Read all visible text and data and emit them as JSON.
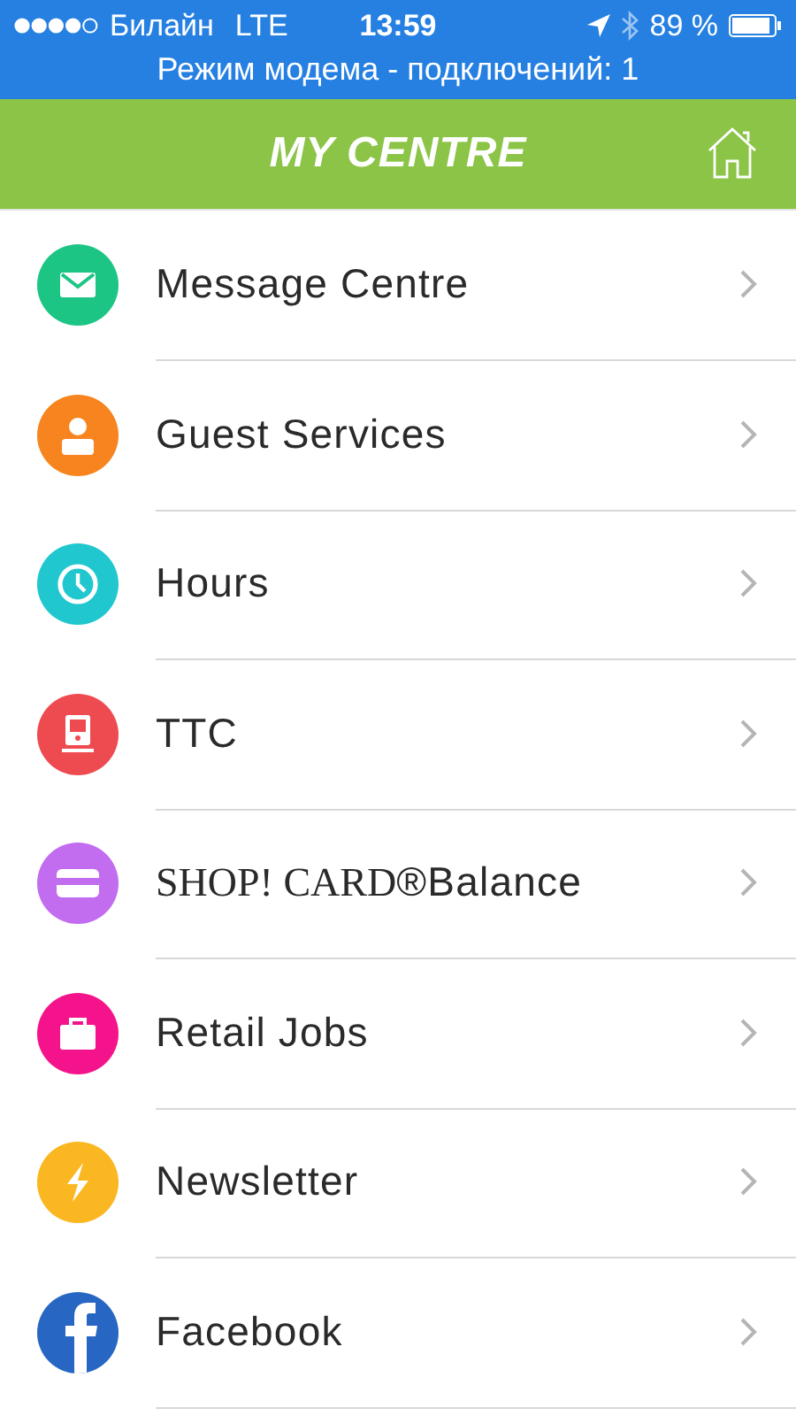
{
  "status_bar": {
    "carrier": "Билайн",
    "network": "LTE",
    "time": "13:59",
    "battery": "89 %"
  },
  "hotspot_banner": "Режим модема - подключений: 1",
  "header": {
    "title": "MY CENTRE"
  },
  "menu": [
    {
      "kind": "mail",
      "label": "Message Centre",
      "color": "#1dc584"
    },
    {
      "kind": "person",
      "label": "Guest Services",
      "color": "#f7841e"
    },
    {
      "kind": "clock",
      "label": "Hours",
      "color": "#20c7cf"
    },
    {
      "kind": "train",
      "label": "TTC",
      "color": "#ee4b50"
    },
    {
      "kind": "card",
      "brand": "SHOP! CARD",
      "label": "®Balance",
      "color": "#c26df0"
    },
    {
      "kind": "briefcase",
      "label": "Retail Jobs",
      "color": "#f5138b"
    },
    {
      "kind": "bolt",
      "label": "Newsletter",
      "color": "#fbb721"
    },
    {
      "kind": "facebook",
      "label": "Facebook",
      "color": "#2766c3"
    }
  ]
}
